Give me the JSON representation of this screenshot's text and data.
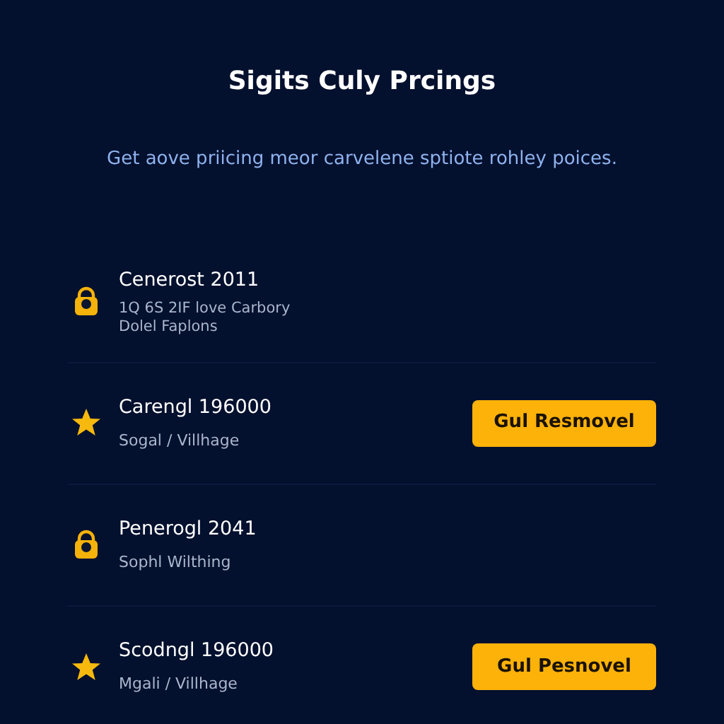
{
  "title": "Sigits Culy Prcings",
  "subtitle": "Get aove priicing meor carvelene sptiote rohley poices.",
  "items": [
    {
      "kind": "lock",
      "name": "Cenerost 2011",
      "details": [
        "1Q 6S 2IF love Carbory",
        "Dolel Faplons"
      ]
    },
    {
      "kind": "star",
      "name": "Carengl 196000",
      "details": [
        "Sogal / Villhage"
      ],
      "button": "Gul Resmovel"
    },
    {
      "kind": "lock",
      "name": "Penerogl 2041",
      "details": [
        "Sophl Wilthing"
      ]
    },
    {
      "kind": "star",
      "name": "Scodngl 196000",
      "details": [
        "Mgali / Villhage"
      ],
      "button": "Gul Pesnovel"
    }
  ]
}
